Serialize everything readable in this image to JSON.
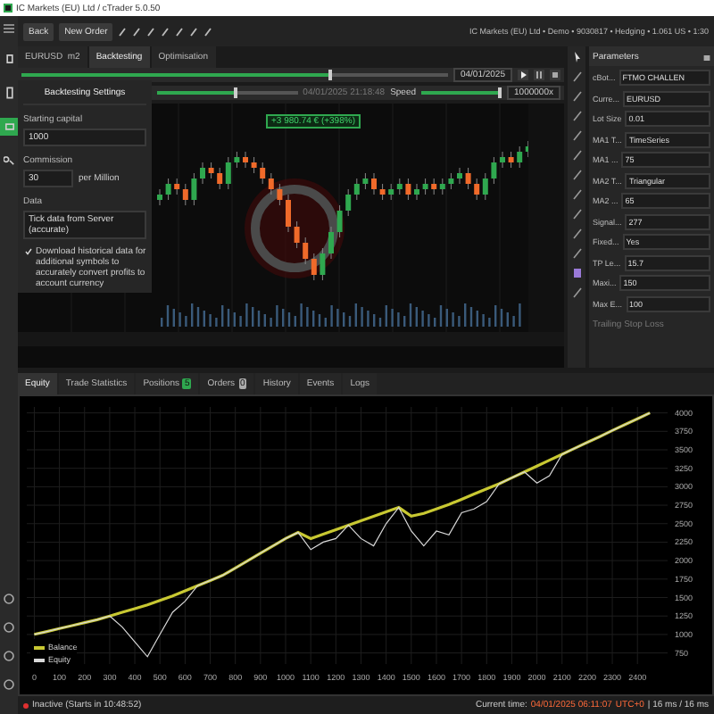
{
  "window": {
    "title": "IC Markets (EU) Ltd / cTrader 5.0.50"
  },
  "sidebar": {
    "items": [
      {
        "selected": false
      },
      {
        "selected": false
      },
      {
        "selected": true
      },
      {
        "selected": false
      }
    ]
  },
  "toolbar": {
    "buttons": [
      "Back",
      "New Order"
    ],
    "account": "IC Markets (EU) Ltd • Demo • 9030817 • Hedging • 1.061 US • 1:30"
  },
  "tabs": [
    {
      "label": "EURUSD  m2",
      "selected": false
    },
    {
      "label": "Backtesting",
      "selected": true
    },
    {
      "label": "Optimisation",
      "selected": false
    }
  ],
  "timeline": {
    "level": 0.72,
    "date": "04/01/2025",
    "progress": {
      "level": 0.55,
      "time": "04/01/2025 21:18:48"
    },
    "speed": {
      "label": "Speed",
      "level": 1,
      "value": "1000000x"
    }
  },
  "settings": {
    "title": "Backtesting Settings",
    "capital_label": "Starting capital",
    "capital": "1000",
    "commission_label": "Commission",
    "commission": "30",
    "commission_unit": "per Million",
    "data_label": "Data",
    "data": "Tick data from Server (accurate)",
    "download_checked": true,
    "download_label": "Download historical data for additional symbols to accurately convert profits to account currency"
  },
  "chart": {
    "profit": "+3 980.74 € (+398%)"
  },
  "parameters": {
    "title": "Parameters",
    "rows": [
      {
        "label": "cBot...",
        "value": "FTMO CHALLEN"
      },
      {
        "label": "Curre...",
        "value": "EURUSD"
      },
      {
        "label": "Lot Size",
        "value": "0.01"
      },
      {
        "label": "MA1 T...",
        "value": "TimeSeries"
      },
      {
        "label": "MA1 ...",
        "value": "75"
      },
      {
        "label": "MA2 T...",
        "value": "Triangular"
      },
      {
        "label": "MA2 ...",
        "value": "65"
      },
      {
        "label": "Signal...",
        "value": "277"
      },
      {
        "label": "Fixed...",
        "value": "Yes"
      },
      {
        "label": "TP Le...",
        "value": "15.7"
      },
      {
        "label": "Maxi...",
        "value": "150"
      },
      {
        "label": "Max E...",
        "value": "100"
      }
    ],
    "section": "Trailing Stop Loss"
  },
  "bottom_tabs": [
    {
      "label": "Equity",
      "selected": true
    },
    {
      "label": "Trade Statistics",
      "selected": false
    },
    {
      "label": "Positions",
      "badge": "5",
      "selected": false
    },
    {
      "label": "Orders",
      "badge": "0",
      "selected": false
    },
    {
      "label": "History",
      "selected": false
    },
    {
      "label": "Events",
      "selected": false
    },
    {
      "label": "Logs",
      "selected": false
    }
  ],
  "equity": {
    "chart_data": {
      "type": "line",
      "x": [
        0,
        50,
        100,
        150,
        200,
        250,
        300,
        350,
        400,
        450,
        500,
        550,
        600,
        650,
        700,
        750,
        800,
        850,
        900,
        950,
        1000,
        1050,
        1100,
        1150,
        1200,
        1250,
        1300,
        1350,
        1400,
        1450,
        1500,
        1550,
        1600,
        1650,
        1700,
        1750,
        1800,
        1850,
        1900,
        1950,
        2000,
        2050,
        2100,
        2150,
        2200,
        2250,
        2300,
        2350,
        2400,
        2450
      ],
      "series": [
        {
          "name": "Balance",
          "color": "#c8c832",
          "values": [
            1000,
            1040,
            1080,
            1120,
            1160,
            1200,
            1250,
            1300,
            1350,
            1400,
            1460,
            1520,
            1590,
            1660,
            1730,
            1800,
            1900,
            2000,
            2100,
            2200,
            2300,
            2380,
            2300,
            2360,
            2420,
            2480,
            2540,
            2600,
            2660,
            2720,
            2600,
            2640,
            2700,
            2760,
            2830,
            2900,
            2970,
            3040,
            3120,
            3200,
            3280,
            3360,
            3440,
            3520,
            3600,
            3680,
            3760,
            3840,
            3920,
            4000
          ]
        },
        {
          "name": "Equity",
          "color": "#d8d8d8",
          "values": [
            1000,
            1040,
            1080,
            1120,
            1160,
            1200,
            1250,
            1100,
            900,
            700,
            1000,
            1300,
            1450,
            1660,
            1730,
            1800,
            1900,
            2000,
            2100,
            2200,
            2300,
            2380,
            2150,
            2250,
            2300,
            2480,
            2300,
            2200,
            2500,
            2720,
            2400,
            2200,
            2400,
            2350,
            2650,
            2700,
            2800,
            3040,
            3120,
            3200,
            3050,
            3150,
            3440,
            3520,
            3600,
            3680,
            3760,
            3840,
            3920,
            4000
          ]
        }
      ],
      "grid": true,
      "legend": "lower left",
      "xlim": [
        -30,
        2520
      ],
      "ylim": [
        600,
        4080
      ],
      "xticks": [
        0,
        100,
        200,
        300,
        400,
        500,
        600,
        700,
        800,
        900,
        1000,
        1100,
        1200,
        1300,
        1400,
        1500,
        1600,
        1700,
        1800,
        1900,
        2000,
        2100,
        2200,
        2300,
        2400
      ],
      "yticks": [
        750,
        1000,
        1250,
        1500,
        1750,
        2000,
        2250,
        2500,
        2750,
        3000,
        3250,
        3500,
        3750,
        4000
      ]
    }
  },
  "status": {
    "state": "Inactive (Starts in 10:48:52)",
    "time_label": "Current time:",
    "time": "04/01/2025 06:11:07",
    "zone": "UTC+0",
    "latency": "| 16 ms / 16 ms"
  }
}
